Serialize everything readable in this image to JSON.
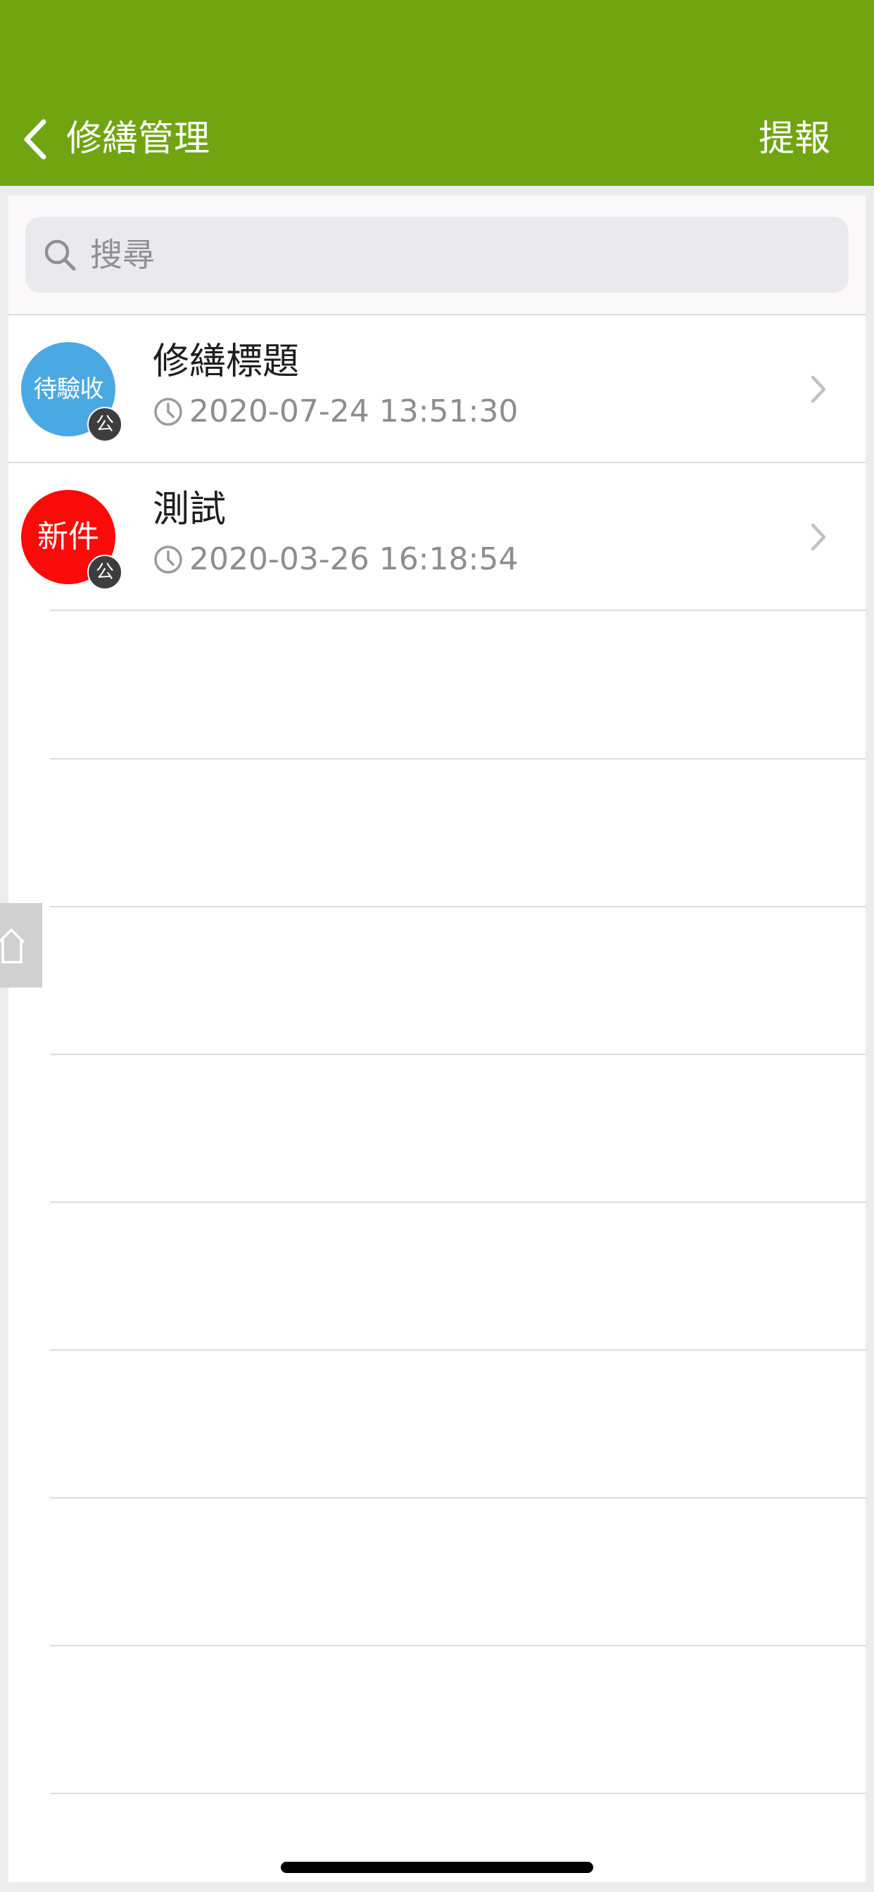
{
  "header": {
    "title": "修繕管理",
    "action_label": "提報",
    "background": "#70a411"
  },
  "search": {
    "placeholder": "搜尋",
    "value": ""
  },
  "items": [
    {
      "title": "修繕標題",
      "status": "待驗收",
      "status_color": "#4aa9e2",
      "tag": "公",
      "datetime": "2020-07-24 13:51:30"
    },
    {
      "title": "測試",
      "status": "新件",
      "status_color": "#fb0a0a",
      "tag": "公",
      "datetime": "2020-03-26 16:18:54"
    }
  ],
  "icons": {
    "back": "chevron-left-icon",
    "search": "search-icon",
    "clock": "clock-icon",
    "row_chevron": "chevron-right-icon",
    "home": "home-icon"
  }
}
